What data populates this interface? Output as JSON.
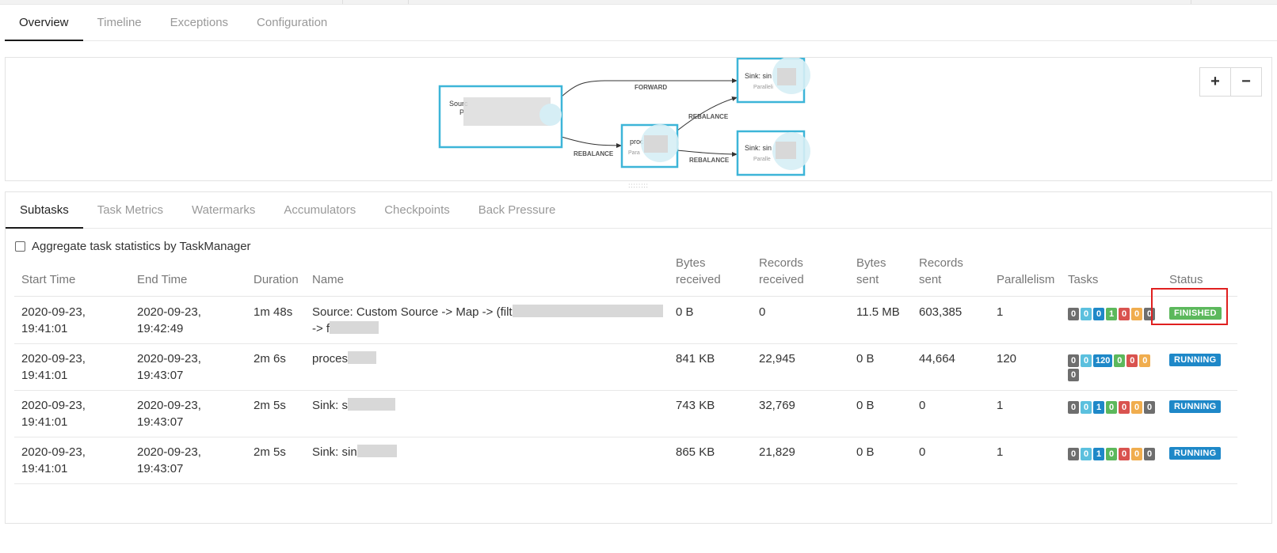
{
  "top_tabs": [
    {
      "label": "Overview",
      "active": true
    },
    {
      "label": "Timeline",
      "active": false
    },
    {
      "label": "Exceptions",
      "active": false
    },
    {
      "label": "Configuration",
      "active": false
    }
  ],
  "graph": {
    "nodes": [
      {
        "title": "Sourc",
        "subtitle": "P"
      },
      {
        "title": "proc",
        "subtitle": "Para"
      },
      {
        "title": "Sink: sin",
        "subtitle": "Paralleli"
      },
      {
        "title": "Sink: sin",
        "subtitle": "Paralle"
      }
    ],
    "edges": [
      "FORWARD",
      "REBALANCE",
      "REBALANCE",
      "REBALANCE"
    ],
    "zoom_in": "+",
    "zoom_out": "−"
  },
  "sub_tabs": [
    {
      "label": "Subtasks",
      "active": true
    },
    {
      "label": "Task Metrics",
      "active": false
    },
    {
      "label": "Watermarks",
      "active": false
    },
    {
      "label": "Accumulators",
      "active": false
    },
    {
      "label": "Checkpoints",
      "active": false
    },
    {
      "label": "Back Pressure",
      "active": false
    }
  ],
  "aggregate_label": "Aggregate task statistics by TaskManager",
  "columns": {
    "start_time": "Start Time",
    "end_time": "End Time",
    "duration": "Duration",
    "name": "Name",
    "bytes_received": [
      "Bytes",
      "received"
    ],
    "records_received": [
      "Records",
      "received"
    ],
    "bytes_sent": [
      "Bytes",
      "sent"
    ],
    "records_sent": [
      "Records",
      "sent"
    ],
    "parallelism": "Parallelism",
    "tasks": "Tasks",
    "status": "Status"
  },
  "rows": [
    {
      "start": [
        "2020-09-23,",
        "19:41:01"
      ],
      "end": [
        "2020-09-23,",
        "19:42:49"
      ],
      "duration": "1m 48s",
      "name": [
        "Source: Custom Source -> Map -> (filt",
        "-> f"
      ],
      "bytes_received": "0 B",
      "records_received": "0",
      "bytes_sent": "11.5 MB",
      "records_sent": "603,385",
      "parallelism": "1",
      "tasks": [
        "0",
        "0",
        "0",
        "1",
        "0",
        "0",
        "0"
      ],
      "status": "FINISHED"
    },
    {
      "start": [
        "2020-09-23,",
        "19:41:01"
      ],
      "end": [
        "2020-09-23,",
        "19:43:07"
      ],
      "duration": "2m 6s",
      "name": [
        "proces",
        ""
      ],
      "bytes_received": "841 KB",
      "records_received": "22,945",
      "bytes_sent": "0 B",
      "records_sent": "44,664",
      "parallelism": "120",
      "tasks": [
        "0",
        "0",
        "120",
        "0",
        "0",
        "0",
        "0"
      ],
      "status": "RUNNING"
    },
    {
      "start": [
        "2020-09-23,",
        "19:41:01"
      ],
      "end": [
        "2020-09-23,",
        "19:43:07"
      ],
      "duration": "2m 5s",
      "name": [
        "Sink: s",
        ""
      ],
      "bytes_received": "743 KB",
      "records_received": "32,769",
      "bytes_sent": "0 B",
      "records_sent": "0",
      "parallelism": "1",
      "tasks": [
        "0",
        "0",
        "1",
        "0",
        "0",
        "0",
        "0"
      ],
      "status": "RUNNING"
    },
    {
      "start": [
        "2020-09-23,",
        "19:41:01"
      ],
      "end": [
        "2020-09-23,",
        "19:43:07"
      ],
      "duration": "2m 5s",
      "name": [
        "Sink: sin",
        ""
      ],
      "bytes_received": "865 KB",
      "records_received": "21,829",
      "bytes_sent": "0 B",
      "records_sent": "0",
      "parallelism": "1",
      "tasks": [
        "0",
        "0",
        "1",
        "0",
        "0",
        "0",
        "0"
      ],
      "status": "RUNNING"
    }
  ]
}
